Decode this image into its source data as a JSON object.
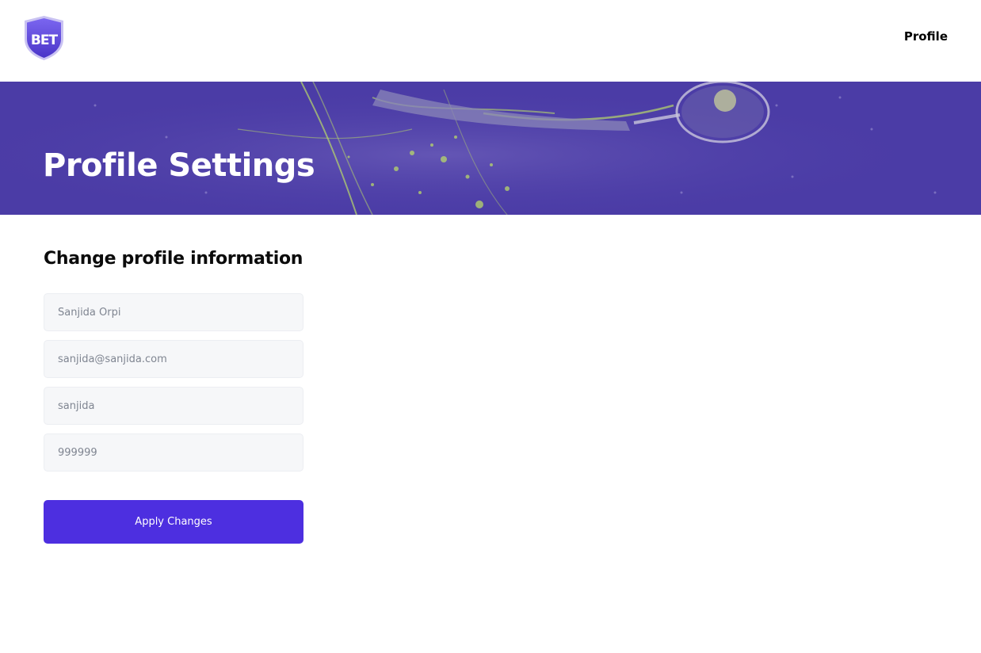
{
  "brand": {
    "logo_text": "BET",
    "color": "#5a44d6"
  },
  "nav": {
    "profile_label": "Profile"
  },
  "banner": {
    "title": "Profile Settings"
  },
  "form": {
    "title": "Change profile information",
    "fields": [
      {
        "name": "full-name",
        "value": "Sanjida Orpi"
      },
      {
        "name": "email",
        "value": "sanjida@sanjida.com"
      },
      {
        "name": "username",
        "value": "sanjida"
      },
      {
        "name": "phone",
        "value": "999999"
      }
    ],
    "submit_label": "Apply Changes"
  },
  "colors": {
    "accent": "#4d2fe0",
    "banner_purple": "#4d3ea8",
    "banner_highlight": "#b8d86a"
  }
}
